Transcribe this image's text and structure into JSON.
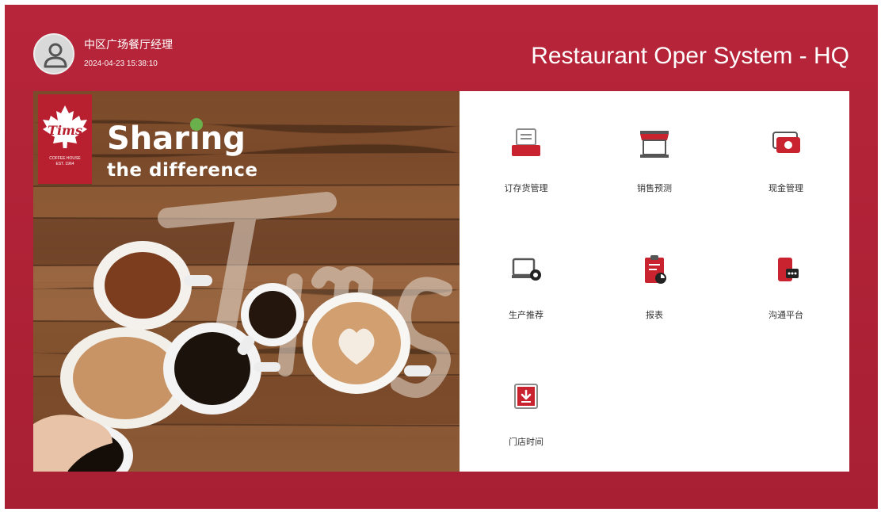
{
  "header": {
    "user_name": "中区广场餐厅经理",
    "timestamp": "2024-04-23 15:38:10",
    "system_title": "Restaurant Oper System - HQ",
    "avatar_icon": "user-icon"
  },
  "hero": {
    "brand_logo_text": "Tims",
    "brand_small_text": "COFFEE HOUSE\nEST. 1964",
    "tagline_line1": "Sharing",
    "tagline_line2": "the difference",
    "watermark_text": "Tims"
  },
  "tiles": [
    {
      "label": "订存货管理",
      "icon": "receipt-printer-icon"
    },
    {
      "label": "销售预测",
      "icon": "storefront-icon"
    },
    {
      "label": "现金管理",
      "icon": "cash-icon"
    },
    {
      "label": "生产推荐",
      "icon": "laptop-gear-icon"
    },
    {
      "label": "报表",
      "icon": "report-clipboard-icon"
    },
    {
      "label": "沟通平台",
      "icon": "chat-phone-icon"
    },
    {
      "label": "门店时间",
      "icon": "download-calendar-icon"
    }
  ],
  "colors": {
    "brand_red": "#b9202f",
    "background_red": "#b7253a",
    "tile_label": "#333333"
  }
}
